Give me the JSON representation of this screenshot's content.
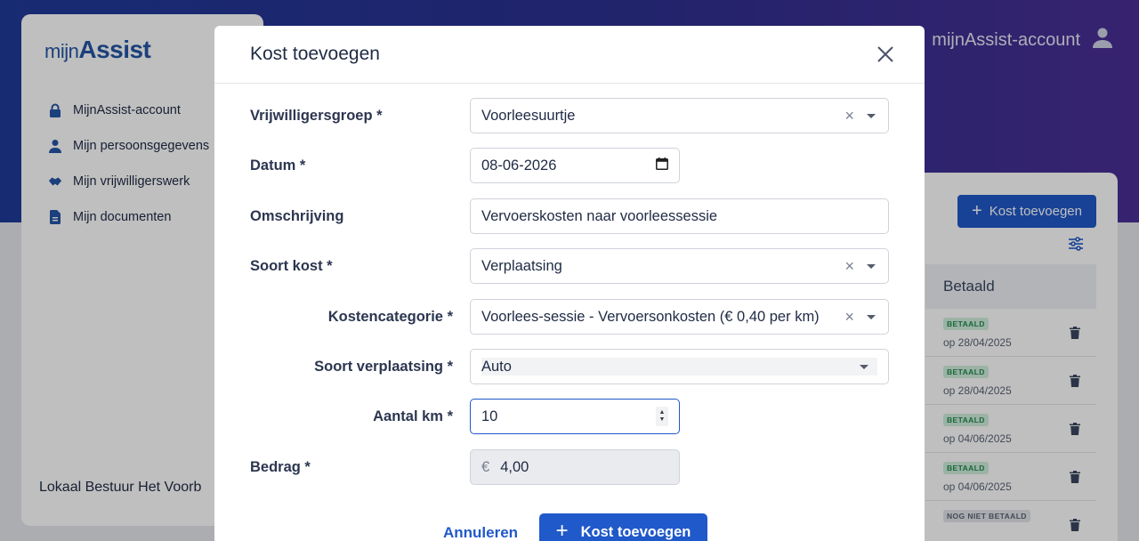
{
  "app": {
    "logo_mijn": "mijn",
    "logo_assist": "Assist",
    "account_label": "mijnAssist-account",
    "sidebar": {
      "items": [
        {
          "label": "MijnAssist-account",
          "icon": "lock-icon"
        },
        {
          "label": "Mijn persoonsgegevens",
          "icon": "person-icon"
        },
        {
          "label": "Mijn vrijwilligerswerk",
          "icon": "handshake-icon"
        },
        {
          "label": "Mijn documenten",
          "icon": "document-icon"
        }
      ],
      "footer": "Lokaal Bestuur Het Voorb"
    },
    "panel": {
      "add_label": "Kost toevoegen",
      "column_header": "Betaald",
      "rows": [
        {
          "badge": "BETAALD",
          "date": "op 28/04/2025",
          "status": "paid"
        },
        {
          "badge": "BETAALD",
          "date": "op 28/04/2025",
          "status": "paid"
        },
        {
          "badge": "BETAALD",
          "date": "op 04/06/2025",
          "status": "paid"
        },
        {
          "badge": "BETAALD",
          "date": "op 04/06/2025",
          "status": "paid"
        },
        {
          "badge": "NOG NIET BETAALD",
          "date": "",
          "status": "unpaid"
        }
      ]
    }
  },
  "modal": {
    "title": "Kost toevoegen",
    "fields": {
      "group": {
        "label": "Vrijwilligersgroep *",
        "value": "Voorleesuurtje"
      },
      "date": {
        "label": "Datum *",
        "value": "08-06-2026"
      },
      "description": {
        "label": "Omschrijving",
        "value": "Vervoerskosten naar voorleessessie"
      },
      "cost_type": {
        "label": "Soort kost *",
        "value": "Verplaatsing"
      },
      "cost_category": {
        "label": "Kostencategorie *",
        "value": "Voorlees-sessie - Vervoersonkosten (€ 0,40 per km)"
      },
      "travel_type": {
        "label": "Soort verplaatsing *",
        "value": "Auto"
      },
      "km": {
        "label": "Aantal km *",
        "value": "10"
      },
      "amount": {
        "label": "Bedrag *",
        "currency": "€",
        "value": "4,00"
      }
    },
    "cancel_label": "Annuleren",
    "submit_label": "Kost toevoegen"
  },
  "colors": {
    "primary": "#2059c9",
    "header_gradient_start": "#1f3a9a",
    "header_gradient_end": "#4a2f95",
    "paid_badge": "#1f8a4e"
  }
}
